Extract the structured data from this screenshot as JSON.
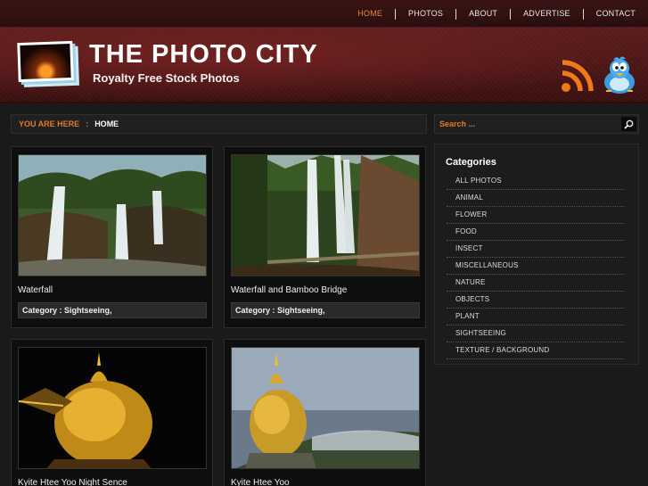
{
  "nav": {
    "items": [
      {
        "label": "HOME",
        "active": true
      },
      {
        "label": "PHOTOS",
        "active": false
      },
      {
        "label": "ABOUT",
        "active": false
      },
      {
        "label": "ADVERTISE",
        "active": false
      },
      {
        "label": "CONTACT",
        "active": false
      }
    ]
  },
  "header": {
    "title": "THE PHOTO CITY",
    "tagline": "Royalty Free Stock Photos",
    "icons": [
      "rss-icon",
      "twitter-bird-icon"
    ]
  },
  "breadcrumb": {
    "label": "YOU ARE HERE",
    "separator": ":",
    "current": "HOME"
  },
  "search": {
    "placeholder": "Search ..."
  },
  "posts": [
    {
      "title": "Waterfall",
      "category": "Category : Sightseeing,"
    },
    {
      "title": "Waterfall and Bamboo Bridge",
      "category": "Category : Sightseeing,"
    },
    {
      "title": "Kyite Htee Yoo Night Sence",
      "category": ""
    },
    {
      "title": "Kyite Htee Yoo",
      "category": ""
    }
  ],
  "sidebar": {
    "heading": "Categories",
    "items": [
      "ALL PHOTOS",
      "ANIMAL",
      "FLOWER",
      "FOOD",
      "INSECT",
      "MISCELLANEOUS",
      "NATURE",
      "OBJECTS",
      "PLANT",
      "SIGHTSEEING",
      "TEXTURE / BACKGROUND"
    ]
  },
  "colors": {
    "accent": "#e07a2a",
    "header_red": "#5c1c1c",
    "background": "#1a1a1a"
  }
}
